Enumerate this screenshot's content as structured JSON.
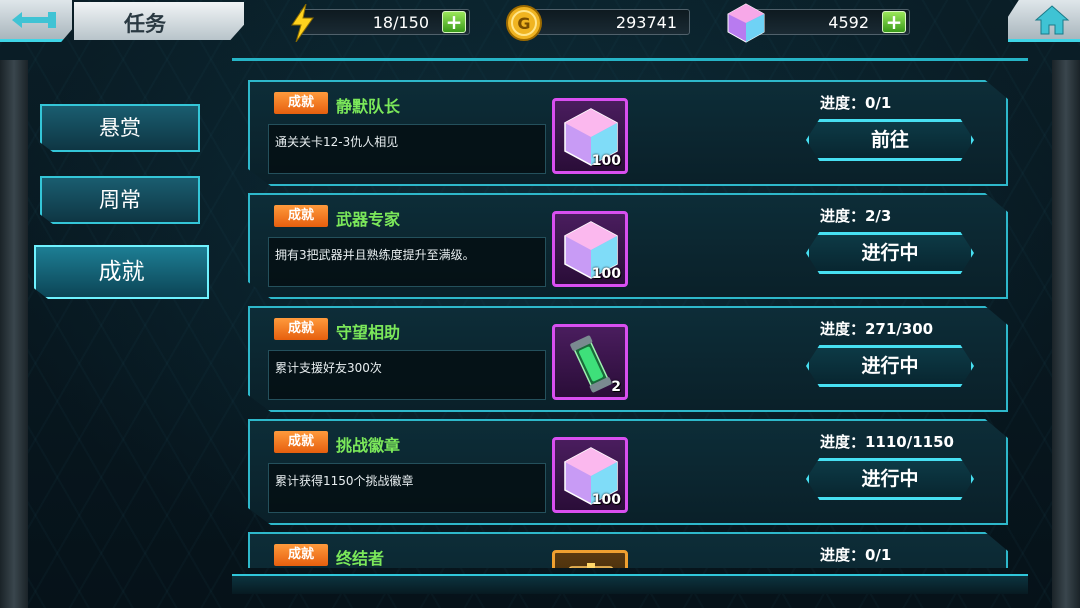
{
  "header": {
    "title": "任务",
    "energy": "18/150",
    "gold": "293741",
    "gems": "4592"
  },
  "tabs": [
    {
      "label": "悬赏"
    },
    {
      "label": "周常"
    },
    {
      "label": "成就"
    }
  ],
  "cards": [
    {
      "badge": "成就",
      "title": "静默队长",
      "desc": "通关关卡12-3仇人相见",
      "reward_icon": "gem-icon",
      "reward_count": "100",
      "progress": "进度：0/1",
      "action": "前往"
    },
    {
      "badge": "成就",
      "title": "武器专家",
      "desc": "拥有3把武器并且熟练度提升至满级。",
      "reward_icon": "gem-icon",
      "reward_count": "100",
      "progress": "进度：2/3",
      "action": "进行中"
    },
    {
      "badge": "成就",
      "title": "守望相助",
      "desc": "累计支援好友300次",
      "reward_icon": "capsule-icon",
      "reward_count": "2",
      "progress": "进度：271/300",
      "action": "进行中"
    },
    {
      "badge": "成就",
      "title": "挑战徽章",
      "desc": "累计获得1150个挑战徽章",
      "reward_icon": "gem-icon",
      "reward_count": "100",
      "progress": "进度：1110/1150",
      "action": "进行中"
    },
    {
      "badge": "成就",
      "title": "终结者",
      "desc": "",
      "reward_icon": "chest-icon",
      "reward_count": "",
      "progress": "进度：0/1",
      "action": ""
    }
  ],
  "colors": {
    "accent": "#2eb8cb",
    "badge": "#e65f0e",
    "title_green": "#7be85a",
    "reward_border": "#d84ff0"
  }
}
